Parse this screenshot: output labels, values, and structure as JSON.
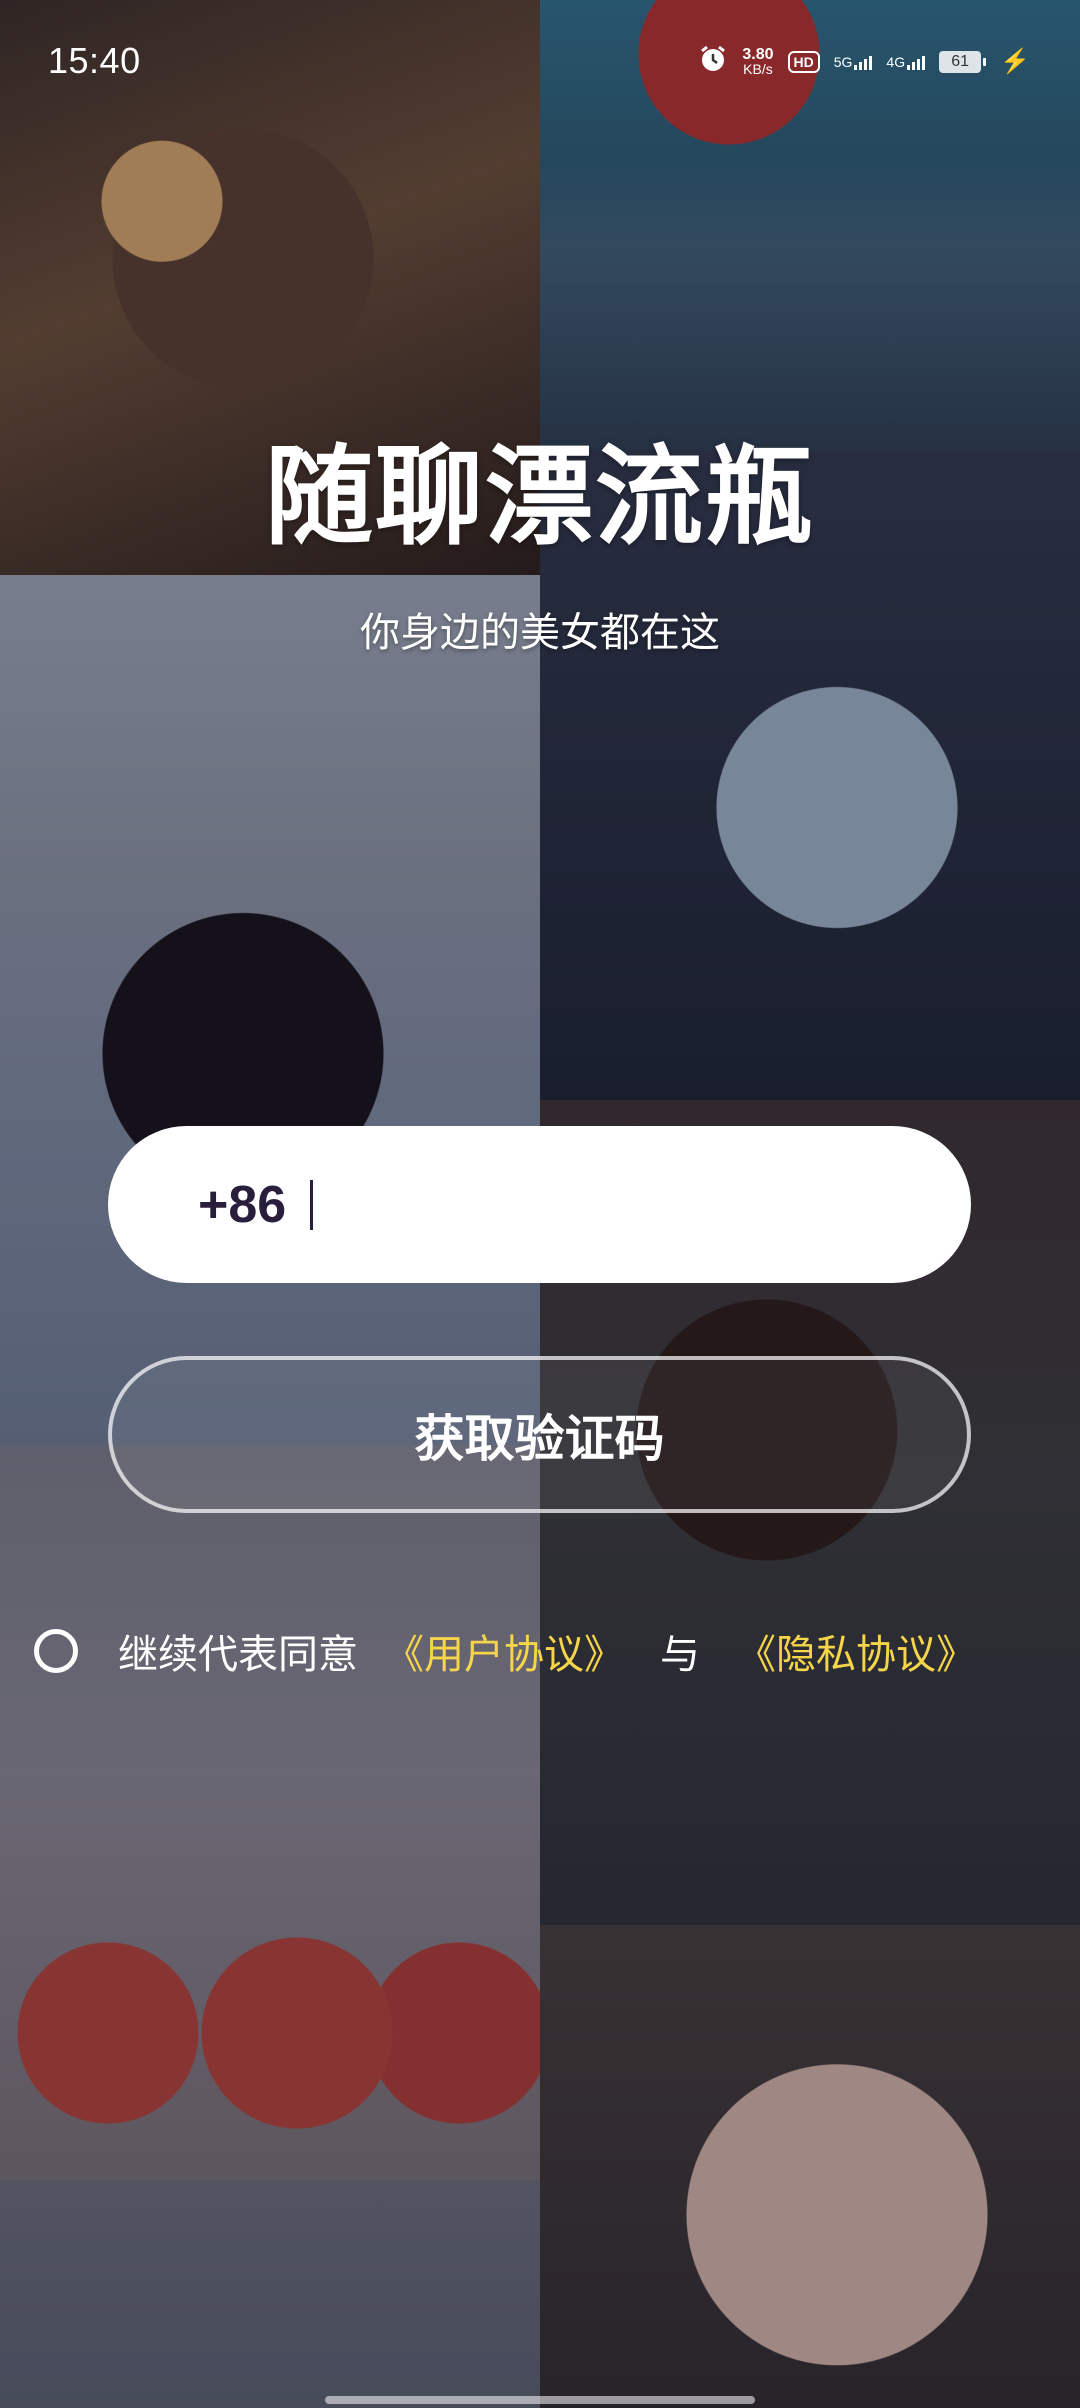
{
  "status_bar": {
    "time": "15:40",
    "net_speed_value": "3.80",
    "net_speed_unit": "KB/s",
    "hd_label": "HD",
    "sim1_label": "5G",
    "sim2_label": "4G",
    "battery_level": "61"
  },
  "app": {
    "title": "随聊漂流瓶",
    "subtitle": "你身边的美女都在这"
  },
  "phone_field": {
    "country_code": "+86",
    "value": "",
    "placeholder": ""
  },
  "buttons": {
    "get_code": "获取验证码"
  },
  "agreement": {
    "prefix": "继续代表同意",
    "user_agreement": "《用户协议》",
    "conjunction": "与",
    "privacy_agreement": "《隐私协议》",
    "checked": false,
    "link_color": "#f7d54b"
  }
}
